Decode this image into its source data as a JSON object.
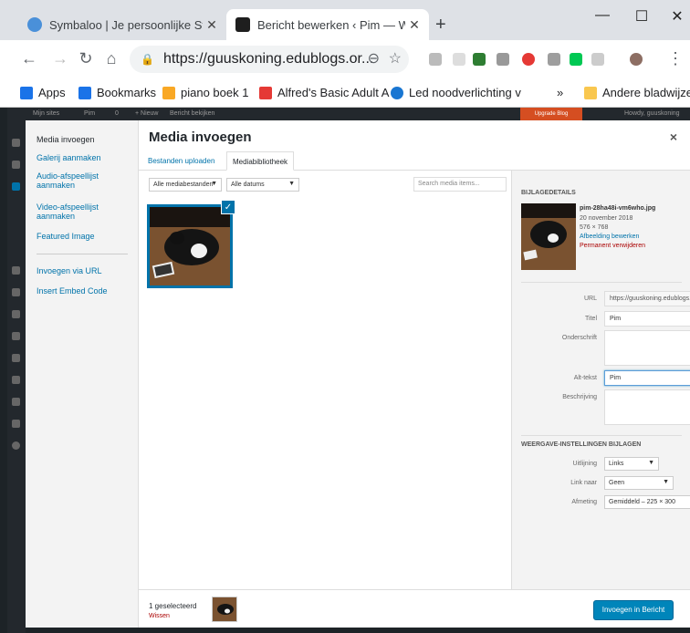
{
  "browser": {
    "tabs": [
      {
        "title": "Symbaloo | Je persoonlijke Startp",
        "favicon": "symbaloo-icon",
        "active": false
      },
      {
        "title": "Bericht bewerken ‹ Pim — WordP",
        "favicon": "edublogs-icon",
        "active": true
      }
    ],
    "new_tab": "+",
    "window_controls": {
      "minimize": "—",
      "maximize": "☐",
      "close": "✕"
    },
    "url": "https://guuskoning.edublogs.or...",
    "bookmarks": [
      {
        "label": "Apps",
        "icon": "apps-grid-icon"
      },
      {
        "label": "Bookmarks",
        "icon": "star-icon"
      },
      {
        "label": "piano boek 1",
        "icon": "piano-icon"
      },
      {
        "label": "Alfred's Basic Adult A",
        "icon": "youtube-icon"
      },
      {
        "label": "Led noodverlichting v",
        "icon": "led-icon"
      },
      {
        "label": "Andere bladwijzers",
        "icon": "folder-icon"
      }
    ],
    "bookmarks_more": "»"
  },
  "wp_admin_bar": {
    "items": [
      "Mijn sites",
      "Pim",
      "0",
      "+ Nieuw",
      "Bericht bekijken"
    ],
    "upgrade": "Upgrade Blog",
    "howdy": "Howdy, guuskoning"
  },
  "modal": {
    "title": "Media invoegen",
    "close": "×",
    "menu": [
      "Media invoegen",
      "Galerij aanmaken",
      "Audio-afspeellijst aanmaken",
      "Video-afspeellijst aanmaken",
      "Featured Image",
      "Invoegen via URL",
      "Insert Embed Code"
    ],
    "tabs": [
      "Bestanden uploaden",
      "Mediabibliotheek"
    ],
    "filter_type": "Alle mediabestanden",
    "filter_date": "Alle datums",
    "search_placeholder": "Search media items...",
    "details": {
      "heading": "BIJLAGEDETAILS",
      "filename": "pim-28ha48i-vm6who.jpg",
      "date": "20 november 2018",
      "dimensions": "576 × 768",
      "edit_link": "Afbeelding bewerken",
      "delete_link": "Permanent verwijderen",
      "url_label": "URL",
      "url_value": "https://guuskoning.edublogs.",
      "title_label": "Titel",
      "title_value": "Pim",
      "caption_label": "Onderschrift",
      "caption_value": "",
      "alt_label": "Alt-tekst",
      "alt_value": "Pim",
      "desc_label": "Beschrijving",
      "desc_value": ""
    },
    "display_settings": {
      "heading": "WEERGAVE-INSTELLINGEN BIJLAGEN",
      "align_label": "Uitlijning",
      "align_value": "Links",
      "link_label": "Link naar",
      "link_value": "Geen",
      "size_label": "Afmeting",
      "size_value": "Gemiddeld – 225 × 300"
    },
    "footer": {
      "selected": "1 geselecteerd",
      "clear": "Wissen",
      "insert_button": "Invoegen in Bericht"
    }
  },
  "colors": {
    "accent": "#0073aa",
    "button": "#0085ba",
    "danger": "#a00"
  }
}
